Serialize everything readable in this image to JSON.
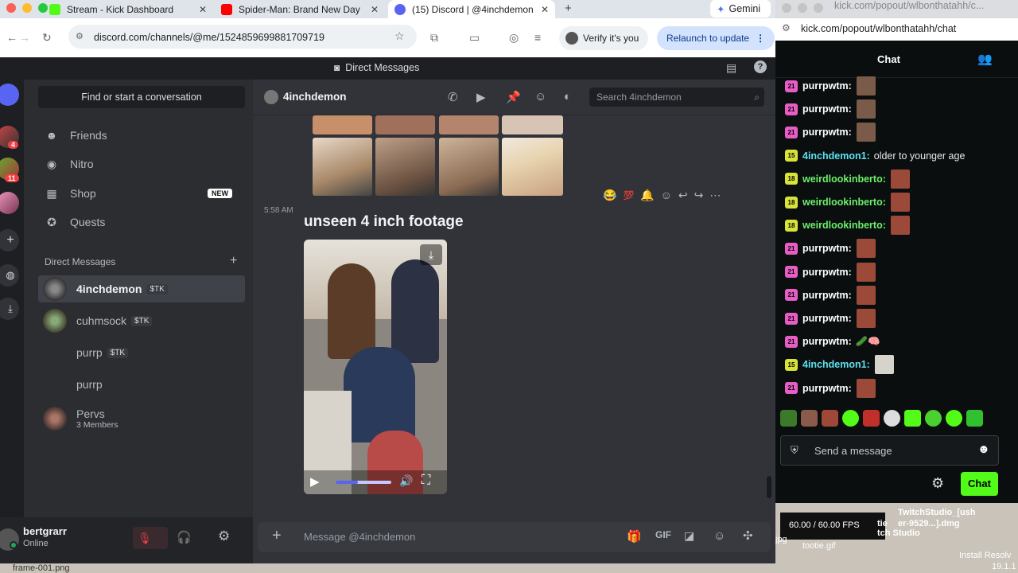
{
  "browser": {
    "tabs": [
      {
        "title": "Stream - Kick Dashboard",
        "color": "#53fc18"
      },
      {
        "title": "Spider-Man: Brand New Day",
        "color": "#ff0000"
      },
      {
        "title": "(15) Discord | @4inchdemon",
        "color": "#5865f2"
      }
    ],
    "new_tab": "+",
    "gemini": "Gemini",
    "url": "discord.com/channels/@me/1524859699881709719",
    "verify": "Verify it's you",
    "relaunch": "Relaunch to update"
  },
  "discord": {
    "top_title": "Direct Messages",
    "find": "Find or start a conversation",
    "nav": [
      {
        "label": "Friends",
        "icon": "friends-icon"
      },
      {
        "label": "Nitro",
        "icon": "nitro-icon"
      },
      {
        "label": "Shop",
        "icon": "shop-icon",
        "badge": "NEW"
      },
      {
        "label": "Quests",
        "icon": "quests-icon"
      }
    ],
    "dm_header": "Direct Messages",
    "dms": [
      {
        "name": "4inchdemon",
        "tag": "$TK",
        "selected": true
      },
      {
        "name": "cuhmsock",
        "tag": "$TK"
      },
      {
        "name": "purrp",
        "tag": "$TK"
      },
      {
        "name": "purrp"
      },
      {
        "name": "Pervs",
        "sub": "3 Members"
      }
    ],
    "guild_badges": [
      "4",
      "11"
    ],
    "user": {
      "name": "bertgrarr",
      "status": "Online"
    },
    "channel": "4inchdemon",
    "search_placeholder": "Search 4inchdemon",
    "timestamp": "5:58 AM",
    "message": "unseen 4 inch footage",
    "composer_placeholder": "Message @4inchdemon"
  },
  "kick": {
    "tab_url": "kick.com/popout/wlbonthatahh/c...",
    "url": "kick.com/popout/wlbonthatahh/chat",
    "title": "Chat",
    "messages": [
      {
        "badge": "21",
        "user": "purrpwtm:",
        "color": "#ffffff",
        "badge_color": "#e85cc6",
        "text": "",
        "emote": "#7a5a48"
      },
      {
        "badge": "21",
        "user": "purrpwtm:",
        "color": "#ffffff",
        "badge_color": "#e85cc6",
        "text": "",
        "emote": "#7a5a48"
      },
      {
        "badge": "21",
        "user": "purrpwtm:",
        "color": "#ffffff",
        "badge_color": "#e85cc6",
        "text": "",
        "emote": "#7a5a48"
      },
      {
        "badge": "15",
        "user": "4inchdemon1:",
        "color": "#5ce2f0",
        "badge_color": "#d8e33a",
        "text": "older to younger age",
        "emote": ""
      },
      {
        "badge": "18",
        "user": "weirdlookinberto:",
        "color": "#6cf06a",
        "badge_color": "#d8e33a",
        "text": "",
        "emote": "#9b4a3a"
      },
      {
        "badge": "18",
        "user": "weirdlookinberto:",
        "color": "#6cf06a",
        "badge_color": "#d8e33a",
        "text": "",
        "emote": "#9b4a3a"
      },
      {
        "badge": "18",
        "user": "weirdlookinberto:",
        "color": "#6cf06a",
        "badge_color": "#d8e33a",
        "text": "",
        "emote": "#9b4a3a"
      },
      {
        "badge": "21",
        "user": "purrpwtm:",
        "color": "#ffffff",
        "badge_color": "#e85cc6",
        "text": "",
        "emote": "#9b4a3a"
      },
      {
        "badge": "21",
        "user": "purrpwtm:",
        "color": "#ffffff",
        "badge_color": "#e85cc6",
        "text": "",
        "emote": "#9b4a3a"
      },
      {
        "badge": "21",
        "user": "purrpwtm:",
        "color": "#ffffff",
        "badge_color": "#e85cc6",
        "text": "",
        "emote": "#9b4a3a"
      },
      {
        "badge": "21",
        "user": "purrpwtm:",
        "color": "#ffffff",
        "badge_color": "#e85cc6",
        "text": "",
        "emote": "#9b4a3a"
      },
      {
        "badge": "21",
        "user": "purrpwtm:",
        "color": "#ffffff",
        "badge_color": "#e85cc6",
        "text": "🥒🧠",
        "emote": ""
      },
      {
        "badge": "15",
        "user": "4inchdemon1:",
        "color": "#5ce2f0",
        "badge_color": "#d8e33a",
        "text": "",
        "emote": "#d6d2cc"
      },
      {
        "badge": "21",
        "user": "purrpwtm:",
        "color": "#ffffff",
        "badge_color": "#e85cc6",
        "text": "",
        "emote": "#9b4a3a"
      }
    ],
    "input_placeholder": "Send a message",
    "chat_button": "Chat"
  },
  "desktop": {
    "fps": "60.00 / 60.00 FPS",
    "twitch_studio": "TwitchStudio_[ush",
    "twitch_file": "er-9529...].dmg",
    "studio_label": "tch Studio",
    "tootie": "tootie.gif",
    "resolve": "Install Resolv",
    "resolve_ver": "19.1.1",
    "frame": "frame-001.png",
    "jpg": "jpg",
    "tie": "tie"
  }
}
